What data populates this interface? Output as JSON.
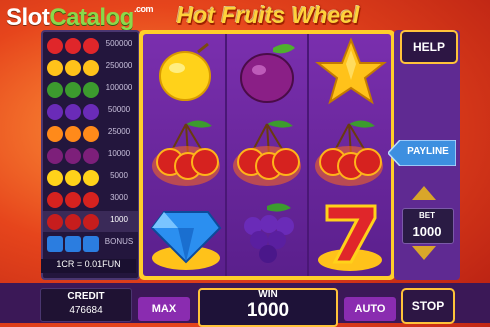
{
  "watermark": {
    "part1": "Slot",
    "part2": "Catalog",
    "suffix": ".com"
  },
  "game_title": "Hot Fruits Wheel",
  "paytable": {
    "rows": [
      {
        "symbol": "seven-icon",
        "payout": "500000",
        "color": "#e0262a"
      },
      {
        "symbol": "star-icon",
        "payout": "250000",
        "color": "#ffc21a"
      },
      {
        "symbol": "watermelon-icon",
        "payout": "100000",
        "color": "#3c9b2e"
      },
      {
        "symbol": "grapes-icon",
        "payout": "50000",
        "color": "#6a2bb8"
      },
      {
        "symbol": "orange-icon",
        "payout": "25000",
        "color": "#ff8a1a"
      },
      {
        "symbol": "plum-icon",
        "payout": "10000",
        "color": "#7d1f7a"
      },
      {
        "symbol": "lemon-icon",
        "payout": "5000",
        "color": "#ffd21a"
      },
      {
        "symbol": "cherry-icon",
        "payout": "3000",
        "color": "#d6221f"
      },
      {
        "symbol": "cherry-icon",
        "payout": "1000",
        "color": "#c71d1d",
        "highlight": true
      },
      {
        "symbol": "diamond-icon",
        "payout": "BONUS",
        "color": "#2b7de0"
      }
    ],
    "conversion": "1CR = 0.01FUN"
  },
  "reels": [
    [
      "lemon-icon",
      "cherry-icon",
      "diamond-icon"
    ],
    [
      "plum-icon",
      "cherry-icon",
      "grapes-icon"
    ],
    [
      "star-icon",
      "cherry-icon",
      "seven-icon"
    ]
  ],
  "buttons": {
    "help": "HELP",
    "payline": "PAYLINE",
    "max": "MAX",
    "auto": "AUTO",
    "stop": "STOP"
  },
  "bet": {
    "label": "BET",
    "value": "1000"
  },
  "credit": {
    "label": "CREDIT",
    "value": "476684"
  },
  "win": {
    "label": "WIN",
    "value": "1000"
  },
  "colors": {
    "frame": "#ffce2a",
    "panel": "#5f2a92",
    "button": "#8a2cb0",
    "background": "#e6451c"
  }
}
